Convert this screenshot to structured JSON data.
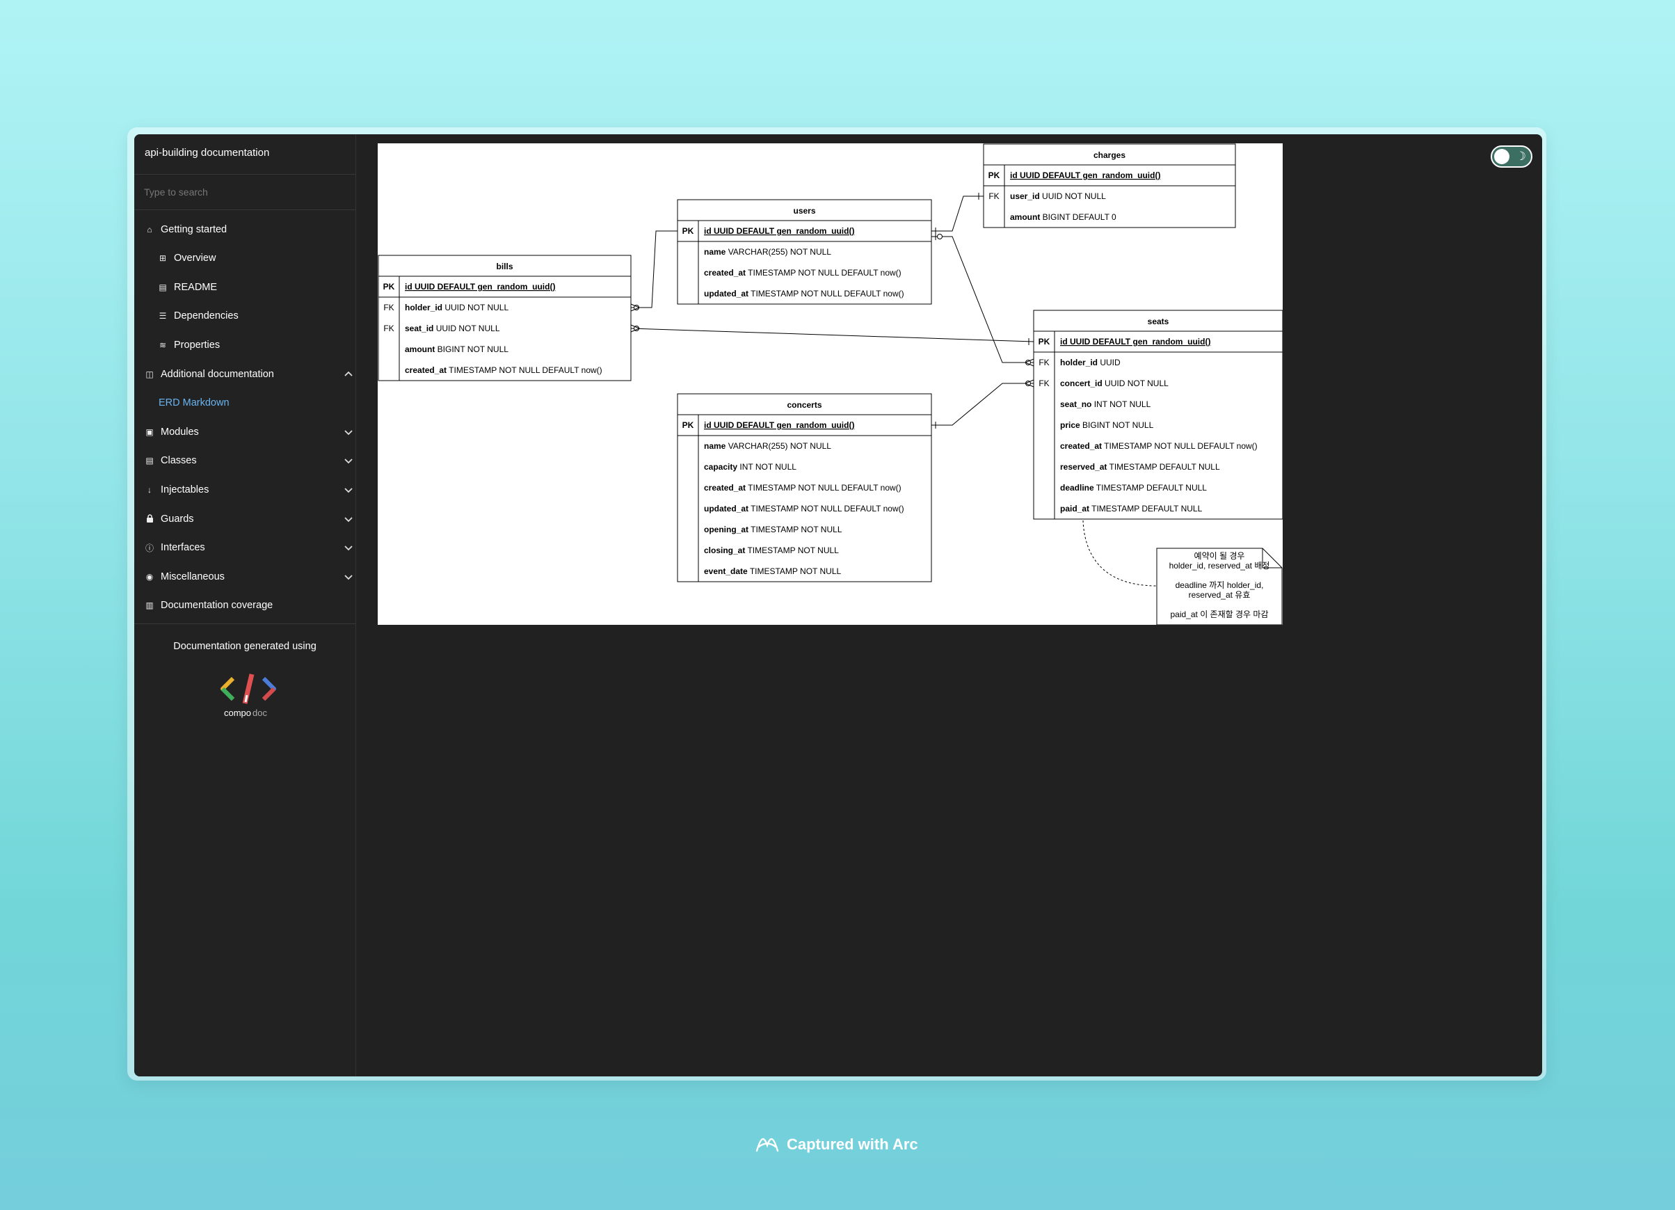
{
  "sidebar": {
    "title": "api-building documentation",
    "search_placeholder": "Type to search",
    "items": [
      {
        "label": "Getting started",
        "icon": "home-icon",
        "glyph": "⌂"
      },
      {
        "label": "Overview",
        "icon": "grid-icon",
        "glyph": "⊞"
      },
      {
        "label": "README",
        "icon": "book-icon",
        "glyph": "▤"
      },
      {
        "label": "Dependencies",
        "icon": "list-icon",
        "glyph": "☰"
      },
      {
        "label": "Properties",
        "icon": "layers-icon",
        "glyph": "≋"
      },
      {
        "label": "Additional documentation",
        "icon": "open-book-icon",
        "glyph": "◫"
      },
      {
        "label": "ERD Markdown",
        "icon": "",
        "glyph": ""
      },
      {
        "label": "Modules",
        "icon": "archive-icon",
        "glyph": "▣"
      },
      {
        "label": "Classes",
        "icon": "file-icon",
        "glyph": "▤"
      },
      {
        "label": "Injectables",
        "icon": "arrow-down-icon",
        "glyph": "↓"
      },
      {
        "label": "Guards",
        "icon": "lock-icon",
        "glyph": "🔒"
      },
      {
        "label": "Interfaces",
        "icon": "info-icon",
        "glyph": "ⓘ"
      },
      {
        "label": "Miscellaneous",
        "icon": "cube-icon",
        "glyph": "◉"
      },
      {
        "label": "Documentation coverage",
        "icon": "bar-chart-icon",
        "glyph": "▥"
      }
    ],
    "footer_text": "Documentation generated using",
    "logo_text_1": "compo",
    "logo_text_2": "doc"
  },
  "erd": {
    "tables": {
      "charges": {
        "title": "charges",
        "rows": [
          {
            "key": "PK",
            "name": "id",
            "type": "UUID DEFAULT gen_random_uuid()"
          },
          {
            "key": "FK",
            "name": "user_id",
            "type": " UUID NOT NULL"
          },
          {
            "key": "",
            "name": "amount",
            "type": " BIGINT DEFAULT 0"
          }
        ]
      },
      "users": {
        "title": "users",
        "rows": [
          {
            "key": "PK",
            "name": "id",
            "type": "UUID DEFAULT gen_random_uuid()"
          },
          {
            "key": "",
            "name": "name",
            "type": " VARCHAR(255) NOT NULL"
          },
          {
            "key": "",
            "name": "created_at",
            "type": " TIMESTAMP NOT NULL DEFAULT now()"
          },
          {
            "key": "",
            "name": "updated_at",
            "type": " TIMESTAMP NOT NULL DEFAULT now()"
          }
        ]
      },
      "bills": {
        "title": "bills",
        "rows": [
          {
            "key": "PK",
            "name": "id",
            "type": "UUID DEFAULT gen_random_uuid()"
          },
          {
            "key": "FK",
            "name": "holder_id",
            "type": " UUID NOT NULL"
          },
          {
            "key": "FK",
            "name": "seat_id",
            "type": " UUID NOT NULL"
          },
          {
            "key": "",
            "name": "amount",
            "type": " BIGINT NOT NULL"
          },
          {
            "key": "",
            "name": "created_at",
            "type": " TIMESTAMP NOT NULL DEFAULT now()"
          }
        ]
      },
      "seats": {
        "title": "seats",
        "rows": [
          {
            "key": "PK",
            "name": "id",
            "type": "UUID DEFAULT gen_random_uuid()"
          },
          {
            "key": "FK",
            "name": "holder_id",
            "type": " UUID"
          },
          {
            "key": "FK",
            "name": "concert_id",
            "type": " UUID NOT NULL"
          },
          {
            "key": "",
            "name": "seat_no",
            "type": " INT NOT NULL"
          },
          {
            "key": "",
            "name": "price",
            "type": " BIGINT NOT NULL"
          },
          {
            "key": "",
            "name": "created_at",
            "type": " TIMESTAMP NOT NULL DEFAULT now()"
          },
          {
            "key": "",
            "name": "reserved_at",
            "type": " TIMESTAMP DEFAULT NULL"
          },
          {
            "key": "",
            "name": "deadline",
            "type": " TIMESTAMP DEFAULT NULL"
          },
          {
            "key": "",
            "name": "paid_at",
            "type": " TIMESTAMP DEFAULT NULL"
          }
        ]
      },
      "concerts": {
        "title": "concerts",
        "rows": [
          {
            "key": "PK",
            "name": "id",
            "type": "UUID DEFAULT gen_random_uuid()"
          },
          {
            "key": "",
            "name": "name",
            "type": " VARCHAR(255) NOT NULL"
          },
          {
            "key": "",
            "name": "capacity",
            "type": " INT NOT NULL"
          },
          {
            "key": "",
            "name": "created_at",
            "type": " TIMESTAMP NOT NULL DEFAULT now()"
          },
          {
            "key": "",
            "name": "updated_at",
            "type": " TIMESTAMP NOT NULL DEFAULT now()"
          },
          {
            "key": "",
            "name": "opening_at",
            "type": " TIMESTAMP NOT NULL"
          },
          {
            "key": "",
            "name": "closing_at",
            "type": " TIMESTAMP NOT NULL"
          },
          {
            "key": "",
            "name": "event_date",
            "type": " TIMESTAMP NOT NULL"
          }
        ]
      }
    },
    "note_lines": [
      "예약이 될 경우",
      "holder_id, reserved_at 배정",
      "",
      "deadline 까지 holder_id,",
      "reserved_at 유효",
      "",
      "paid_at 이 존재할 경우 마감"
    ]
  },
  "theme_toggle": {
    "icon": "moon-icon",
    "glyph": "☽"
  },
  "watermark": {
    "text": "Captured with Arc",
    "icon": "arc-logo-icon"
  },
  "colors": {
    "accent": "#6ab4f0",
    "toggle": "#3c6e62"
  }
}
